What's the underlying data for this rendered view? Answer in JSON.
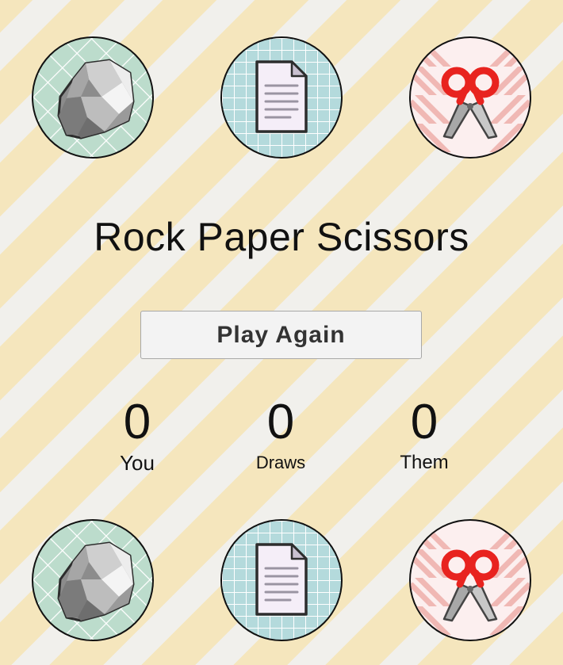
{
  "title": "Rock Paper Scissors",
  "play_again_label": "Play Again",
  "scores": {
    "you": {
      "value": "0",
      "label": "You"
    },
    "draws": {
      "value": "0",
      "label": "Draws"
    },
    "them": {
      "value": "0",
      "label": "Them"
    }
  },
  "choices": [
    "rock",
    "paper",
    "scissors"
  ],
  "icons": {
    "rock": "rock-icon",
    "paper": "paper-icon",
    "scissors": "scissors-icon"
  },
  "colors": {
    "stripe_yellow": "#f5e6bd",
    "stripe_white": "#f1f0ec",
    "rock_bg": "#bcdccc",
    "paper_bg": "#b4dadc",
    "scissors_bg": "#fcefef",
    "scissors_red": "#e8231f"
  }
}
